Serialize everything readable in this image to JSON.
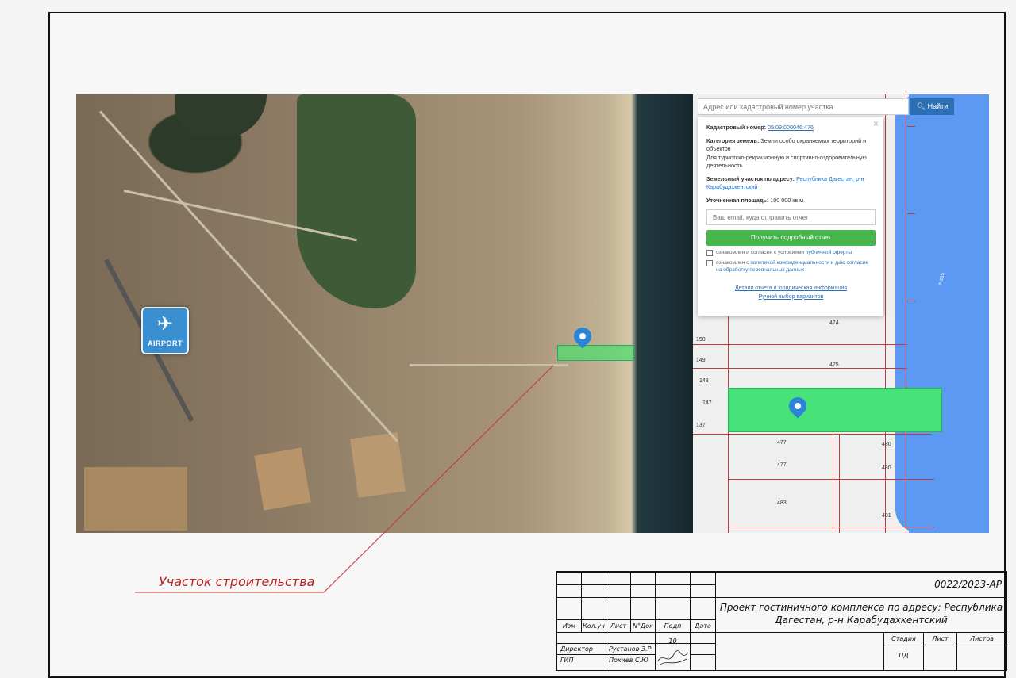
{
  "map": {
    "airport_label": "AIRPORT",
    "search_placeholder": "Адрес или кадастровый номер участка",
    "search_button": "Найти",
    "popup": {
      "cad_num_label": "Кадастровый номер:",
      "cad_num_value": "05:09:000046:476",
      "category_label": "Категория земель:",
      "category_value": "Земли особо охраняемых территорий и объектов",
      "usage": "Для туристско-рекрационную и спортивно-оздоровительную деятельность",
      "address_label": "Земельный участок по адресу:",
      "address_value": "Республика Дагестан, р-н Карабудахкентский",
      "area_label": "Уточненная площадь:",
      "area_value": "100 000 кв.м.",
      "email_placeholder": "Ваш email, куда отправить отчет",
      "report_button": "Получить подробный отчет",
      "check1_text": "ознакомлен и согласен с условиями ",
      "check1_link": "публичной оферты",
      "check2_text": "ознакомлен с ",
      "check2_link": "политикой конфиденциальности и даю согласие на обработку персональных данных",
      "link_details": "Детали отчета и юридическая информация",
      "link_manual": "Ручной выбор вариантов"
    },
    "plot_numbers": [
      "474",
      "475",
      "150",
      "149",
      "148",
      "147",
      "137",
      "477",
      "477",
      "480",
      "480",
      "483",
      "481"
    ],
    "road_sign": "Р-215"
  },
  "site_label": "Участок строительства",
  "title_block": {
    "doc_code": "0022/2023-АР",
    "project_name": "Проект гостиничного комплекса по адресу: Республика Дагестан, р-н Карабудахкентский",
    "col_izm": "Изм",
    "col_koluch": "Кол.уч",
    "col_list": "Лист",
    "col_ndok": "N°Док",
    "col_podp": "Подп",
    "col_data": "Дата",
    "stage_label": "Стадия",
    "sheet_label": "Лист",
    "sheets_label": "Листов",
    "stage_value": "ПД",
    "role1": "Директор",
    "name1": "Рустанов З.Р",
    "role2": "ГИП",
    "name2": "Похиев С.Ю",
    "sig_num": "10"
  }
}
